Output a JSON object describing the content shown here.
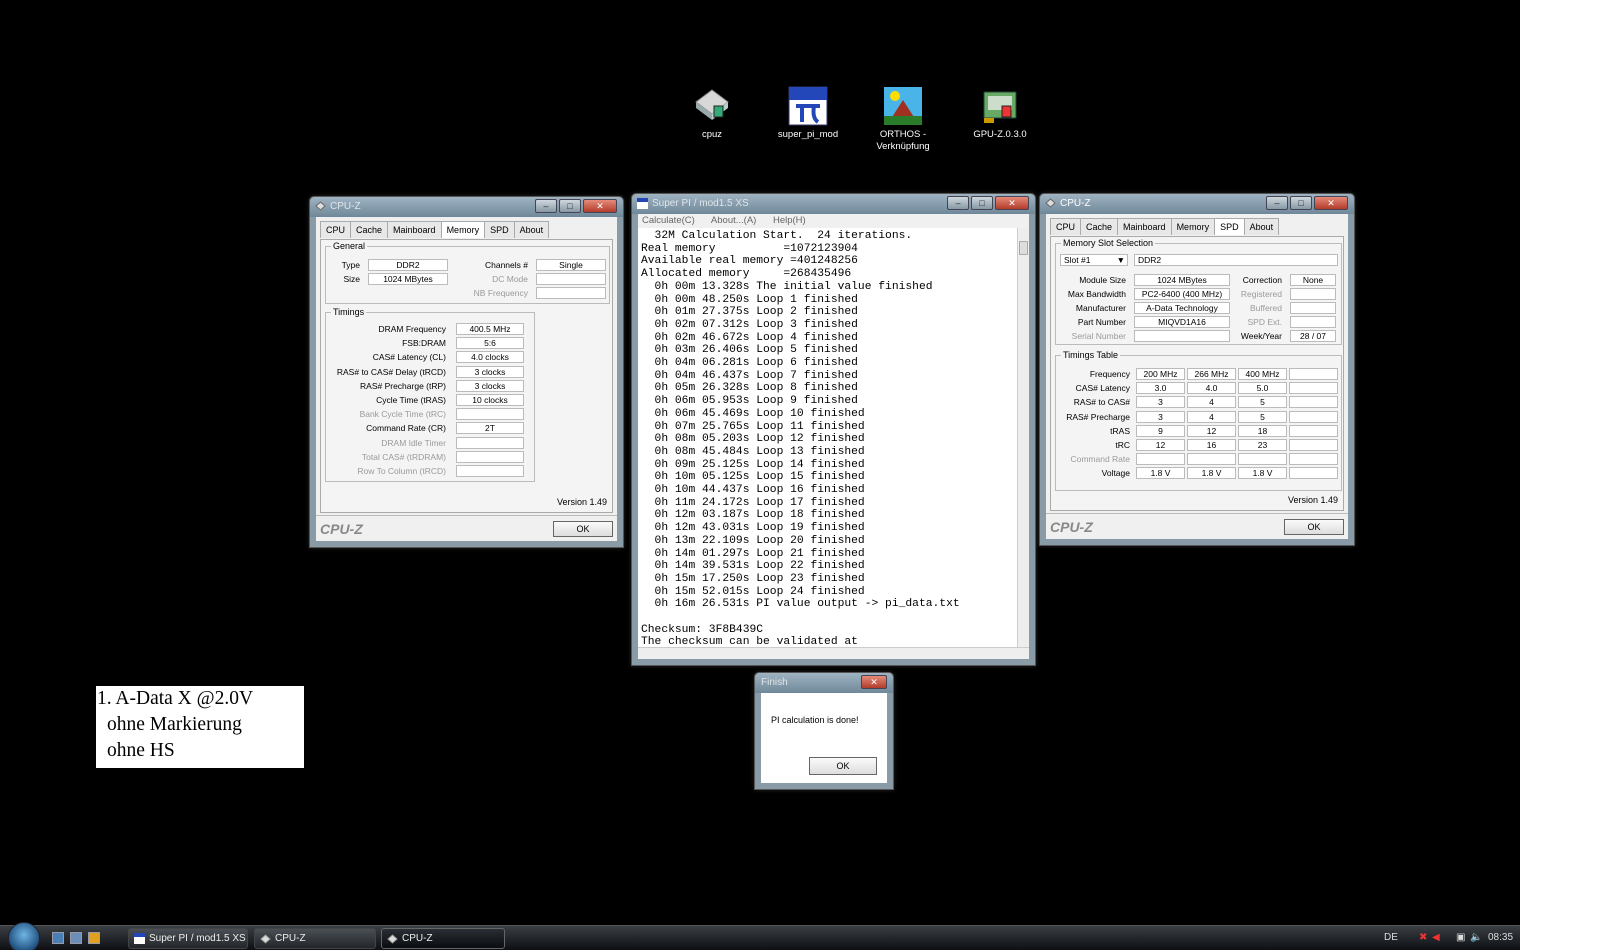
{
  "desktop": {
    "icons": [
      {
        "label": "cpuz"
      },
      {
        "label": "super_pi_mod"
      },
      {
        "label": "ORTHOS - Verknüpfung"
      },
      {
        "label": "GPU-Z.0.3.0"
      }
    ]
  },
  "cpuz_memory": {
    "title": "CPU-Z",
    "tabs": [
      "CPU",
      "Cache",
      "Mainboard",
      "Memory",
      "SPD",
      "About"
    ],
    "active_tab": "Memory",
    "general_label": "General",
    "type_label": "Type",
    "type_value": "DDR2",
    "size_label": "Size",
    "size_value": "1024 MBytes",
    "channels_label": "Channels #",
    "channels_value": "Single",
    "dcmode_label": "DC Mode",
    "nbfreq_label": "NB Frequency",
    "timings_label": "Timings",
    "timings": [
      {
        "label": "DRAM Frequency",
        "value": "400.5 MHz",
        "dim": false
      },
      {
        "label": "FSB:DRAM",
        "value": "5:6",
        "dim": false
      },
      {
        "label": "CAS# Latency (CL)",
        "value": "4.0 clocks",
        "dim": false
      },
      {
        "label": "RAS# to CAS# Delay (tRCD)",
        "value": "3 clocks",
        "dim": false
      },
      {
        "label": "RAS# Precharge (tRP)",
        "value": "3 clocks",
        "dim": false
      },
      {
        "label": "Cycle Time (tRAS)",
        "value": "10 clocks",
        "dim": false
      },
      {
        "label": "Bank Cycle Time (tRC)",
        "value": "",
        "dim": true
      },
      {
        "label": "Command Rate (CR)",
        "value": "2T",
        "dim": false
      },
      {
        "label": "DRAM Idle Timer",
        "value": "",
        "dim": true
      },
      {
        "label": "Total CAS# (tRDRAM)",
        "value": "",
        "dim": true
      },
      {
        "label": "Row To Column (tRCD)",
        "value": "",
        "dim": true
      }
    ],
    "version": "Version 1.49",
    "logo": "CPU-Z",
    "ok": "OK"
  },
  "superpi": {
    "title": "Super PI / mod1.5 XS",
    "menu": [
      "Calculate(C)",
      "About...(A)",
      "Help(H)"
    ],
    "lines": [
      "  32M Calculation Start.  24 iterations.",
      "Real memory          =1072123904",
      "Available real memory =401248256",
      "Allocated memory     =268435496",
      "  0h 00m 13.328s The initial value finished",
      "  0h 00m 48.250s Loop 1 finished",
      "  0h 01m 27.375s Loop 2 finished",
      "  0h 02m 07.312s Loop 3 finished",
      "  0h 02m 46.672s Loop 4 finished",
      "  0h 03m 26.406s Loop 5 finished",
      "  0h 04m 06.281s Loop 6 finished",
      "  0h 04m 46.437s Loop 7 finished",
      "  0h 05m 26.328s Loop 8 finished",
      "  0h 06m 05.953s Loop 9 finished",
      "  0h 06m 45.469s Loop 10 finished",
      "  0h 07m 25.765s Loop 11 finished",
      "  0h 08m 05.203s Loop 12 finished",
      "  0h 08m 45.484s Loop 13 finished",
      "  0h 09m 25.125s Loop 14 finished",
      "  0h 10m 05.125s Loop 15 finished",
      "  0h 10m 44.437s Loop 16 finished",
      "  0h 11m 24.172s Loop 17 finished",
      "  0h 12m 03.187s Loop 18 finished",
      "  0h 12m 43.031s Loop 19 finished",
      "  0h 13m 22.109s Loop 20 finished",
      "  0h 14m 01.297s Loop 21 finished",
      "  0h 14m 39.531s Loop 22 finished",
      "  0h 15m 17.250s Loop 23 finished",
      "  0h 15m 52.015s Loop 24 finished",
      "  0h 16m 26.531s PI value output -> pi_data.txt",
      "",
      "Checksum: 3F8B439C",
      "The checksum can be validated at"
    ]
  },
  "cpuz_spd": {
    "title": "CPU-Z",
    "tabs": [
      "CPU",
      "Cache",
      "Mainboard",
      "Memory",
      "SPD",
      "About"
    ],
    "active_tab": "SPD",
    "slot_group": "Memory Slot Selection",
    "slot": "Slot #1",
    "slot_type": "DDR2",
    "module_size_label": "Module Size",
    "module_size": "1024 MBytes",
    "max_bw_label": "Max Bandwidth",
    "max_bw": "PC2-6400 (400 MHz)",
    "manufacturer_label": "Manufacturer",
    "manufacturer": "A-Data Technology",
    "part_label": "Part Number",
    "part": "MIQVD1A16",
    "serial_label": "Serial Number",
    "correction_label": "Correction",
    "correction": "None",
    "registered_label": "Registered",
    "buffered_label": "Buffered",
    "spdext_label": "SPD Ext.",
    "weekyear_label": "Week/Year",
    "weekyear": "28 / 07",
    "timings_group": "Timings Table",
    "table_rows": [
      {
        "label": "Frequency",
        "cells": [
          "200 MHz",
          "266 MHz",
          "400 MHz",
          ""
        ],
        "dim": false
      },
      {
        "label": "CAS# Latency",
        "cells": [
          "3.0",
          "4.0",
          "5.0",
          ""
        ],
        "dim": false
      },
      {
        "label": "RAS# to CAS#",
        "cells": [
          "3",
          "4",
          "5",
          ""
        ],
        "dim": false
      },
      {
        "label": "RAS# Precharge",
        "cells": [
          "3",
          "4",
          "5",
          ""
        ],
        "dim": false
      },
      {
        "label": "tRAS",
        "cells": [
          "9",
          "12",
          "18",
          ""
        ],
        "dim": false
      },
      {
        "label": "tRC",
        "cells": [
          "12",
          "16",
          "23",
          ""
        ],
        "dim": false
      },
      {
        "label": "Command Rate",
        "cells": [
          "",
          "",
          "",
          ""
        ],
        "dim": true
      },
      {
        "label": "Voltage",
        "cells": [
          "1.8 V",
          "1.8 V",
          "1.8 V",
          ""
        ],
        "dim": false
      }
    ],
    "version": "Version 1.49",
    "logo": "CPU-Z",
    "ok": "OK"
  },
  "finish_dialog": {
    "title": "Finish",
    "message": "PI calculation is done!",
    "ok": "OK"
  },
  "note": {
    "lines": [
      "1. A-Data X  @2.0V",
      " ohne Markierung",
      " ohne HS"
    ]
  },
  "taskbar": {
    "buttons": [
      {
        "label": "Super PI / mod1.5 XS",
        "active": false
      },
      {
        "label": "CPU-Z",
        "active": false
      },
      {
        "label": "CPU-Z",
        "active": true
      }
    ],
    "lang": "DE",
    "clock": "08:35"
  }
}
